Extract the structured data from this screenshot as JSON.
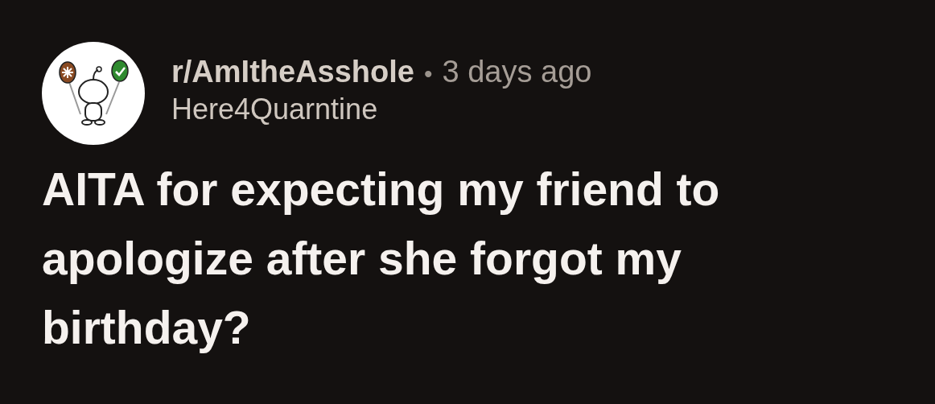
{
  "post": {
    "subreddit": "r/AmItheAsshole",
    "separator": "•",
    "age": "3 days ago",
    "author": "Here4Quarntine",
    "title": "AITA for expecting my friend to apologize after she forgot my birthday?"
  }
}
